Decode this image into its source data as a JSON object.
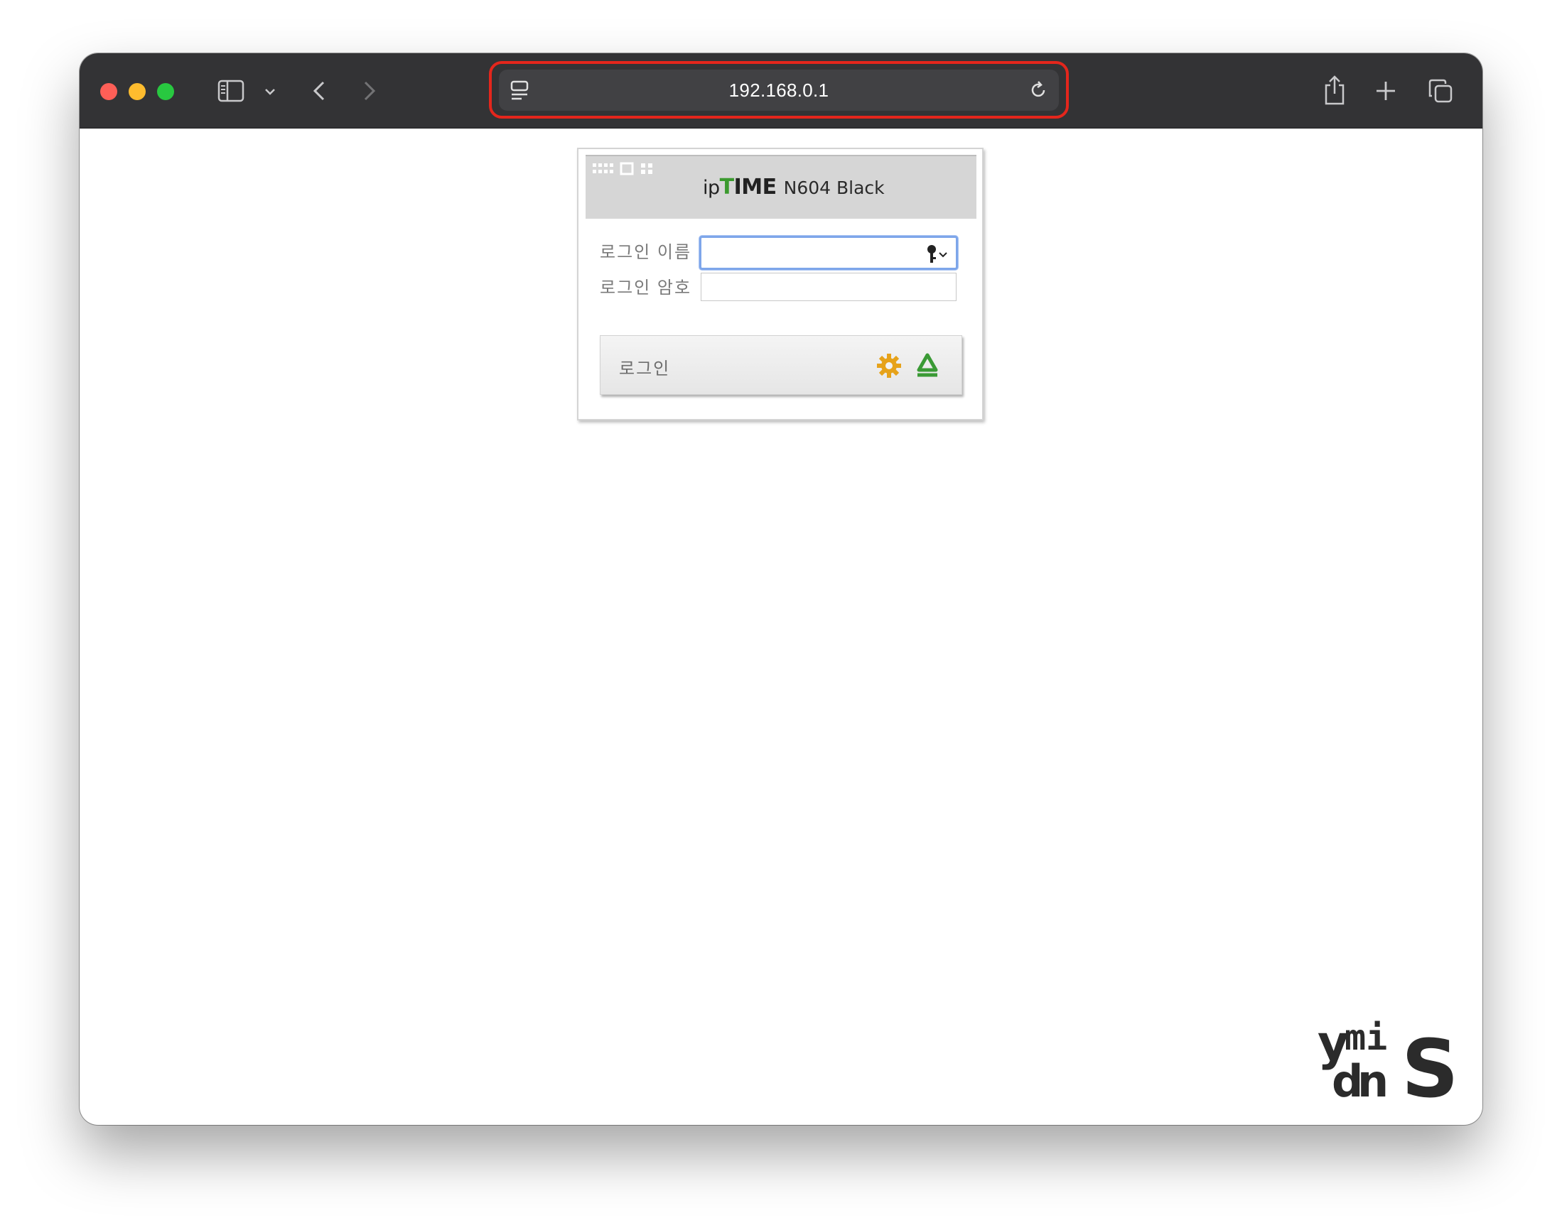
{
  "browser": {
    "address": "192.168.0.1",
    "icons": {
      "sidebar": "sidebar-icon",
      "sidebar_menu": "chevron-down-icon",
      "back": "chevron-left-icon",
      "forward": "chevron-right-icon",
      "page_menu": "page-menu-icon",
      "reload": "reload-icon",
      "share": "share-icon",
      "new_tab": "plus-icon",
      "tabs": "tab-overview-icon"
    },
    "colors": {
      "close": "#fe5f57",
      "minimize": "#febc2e",
      "zoom": "#28c840",
      "highlight": "#e4261c"
    }
  },
  "login": {
    "brand_prefix": "ip",
    "brand_t": "T",
    "brand_rest": "IME",
    "model": "N604 Black",
    "username_label": "로그인 이름",
    "username_value": "",
    "password_label": "로그인 암호",
    "password_value": "",
    "button_label": "로그인",
    "icons": {
      "header_dots": "grid-dots-icon",
      "key": "key-icon",
      "settings": "gear-icon",
      "recycle": "recycle-icon"
    }
  },
  "watermark": {
    "text": "ydmiNS"
  }
}
